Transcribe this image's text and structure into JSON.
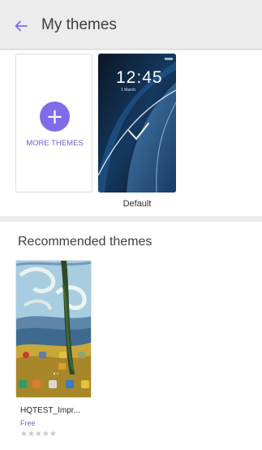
{
  "header": {
    "title": "My themes",
    "back_icon": "arrow-left-icon",
    "accent_color": "#7f6ce8"
  },
  "my_themes": {
    "more_themes_label": "MORE THEMES",
    "add_icon": "plus-icon",
    "default_theme": {
      "label": "Default",
      "clock_time": "12:45",
      "clock_date": "1 March",
      "background_color": "#0d1e33"
    }
  },
  "recommended": {
    "section_title": "Recommended themes",
    "items": [
      {
        "name": "HQTEST_Impr...",
        "price": "Free",
        "rating_stars": 0,
        "stars_total": 5,
        "stars_glyphs": "★★★★★"
      }
    ]
  }
}
